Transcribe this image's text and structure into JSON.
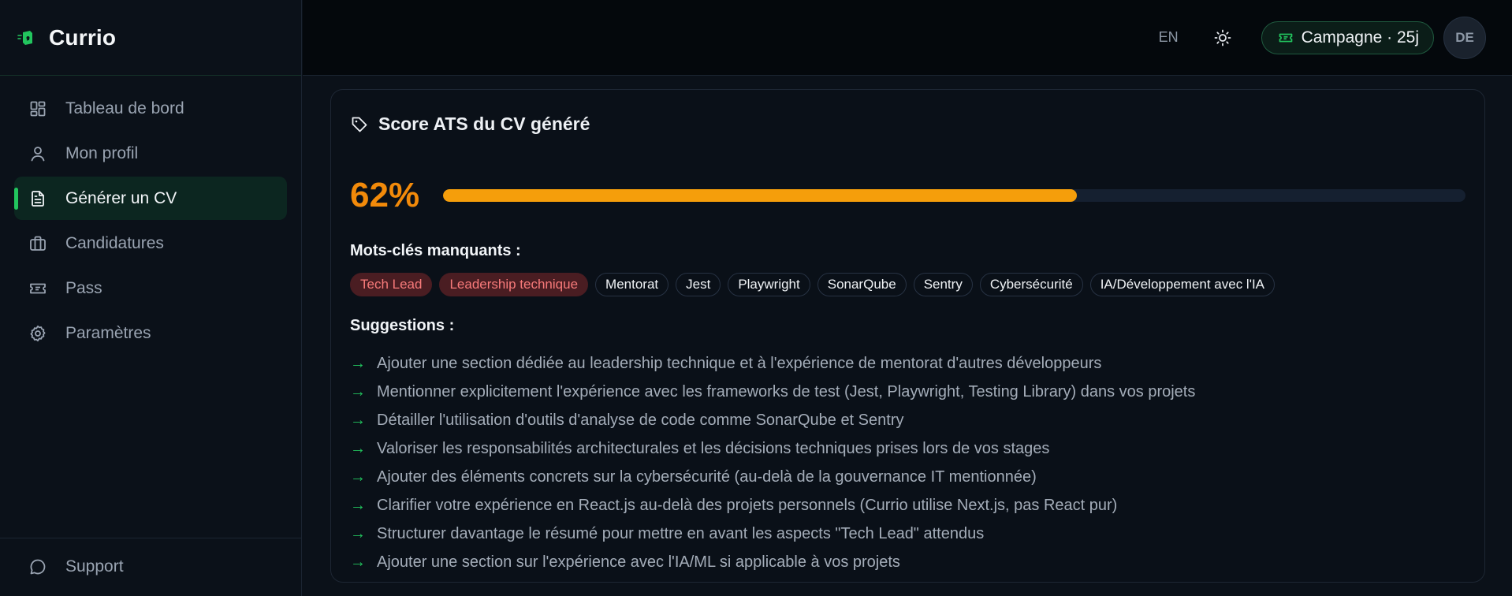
{
  "brand": {
    "name": "Currio"
  },
  "sidebar": {
    "items": [
      {
        "label": "Tableau de bord",
        "icon": "dashboard-icon"
      },
      {
        "label": "Mon profil",
        "icon": "user-icon"
      },
      {
        "label": "Générer un CV",
        "icon": "document-icon",
        "active": true
      },
      {
        "label": "Candidatures",
        "icon": "briefcase-icon"
      },
      {
        "label": "Pass",
        "icon": "ticket-icon"
      },
      {
        "label": "Paramètres",
        "icon": "gear-icon"
      }
    ],
    "footer": {
      "label": "Support",
      "icon": "chat-icon"
    }
  },
  "header": {
    "lang": "EN",
    "campaign_label": "Campagne · 25j",
    "avatar_initials": "DE"
  },
  "card": {
    "title": "Score ATS du CV généré",
    "score_text": "62%",
    "score_percent": 62,
    "missing_label": "Mots-clés manquants :",
    "keywords": [
      {
        "label": "Tech Lead",
        "critical": true
      },
      {
        "label": "Leadership technique",
        "critical": true
      },
      {
        "label": "Mentorat",
        "critical": false
      },
      {
        "label": "Jest",
        "critical": false
      },
      {
        "label": "Playwright",
        "critical": false
      },
      {
        "label": "SonarQube",
        "critical": false
      },
      {
        "label": "Sentry",
        "critical": false
      },
      {
        "label": "Cybersécurité",
        "critical": false
      },
      {
        "label": "IA/Développement avec l'IA",
        "critical": false
      }
    ],
    "suggestions_label": "Suggestions :",
    "arrow": "→",
    "suggestions": [
      "Ajouter une section dédiée au leadership technique et à l'expérience de mentorat d'autres développeurs",
      "Mentionner explicitement l'expérience avec les frameworks de test (Jest, Playwright, Testing Library) dans vos projets",
      "Détailler l'utilisation d'outils d'analyse de code comme SonarQube et Sentry",
      "Valoriser les responsabilités architecturales et les décisions techniques prises lors de vos stages",
      "Ajouter des éléments concrets sur la cybersécurité (au-delà de la gouvernance IT mentionnée)",
      "Clarifier votre expérience en React.js au-delà des projets personnels (Currio utilise Next.js, pas React pur)",
      "Structurer davantage le résumé pour mettre en avant les aspects \"Tech Lead\" attendus",
      "Ajouter une section sur l'expérience avec l'IA/ML si applicable à vos projets"
    ]
  },
  "colors": {
    "accent": "#22c55e",
    "score": "#f28a0a",
    "progress": "#f59e0b",
    "critical_tag_bg": "#4a1d22",
    "critical_tag_text": "#f77a7a"
  }
}
